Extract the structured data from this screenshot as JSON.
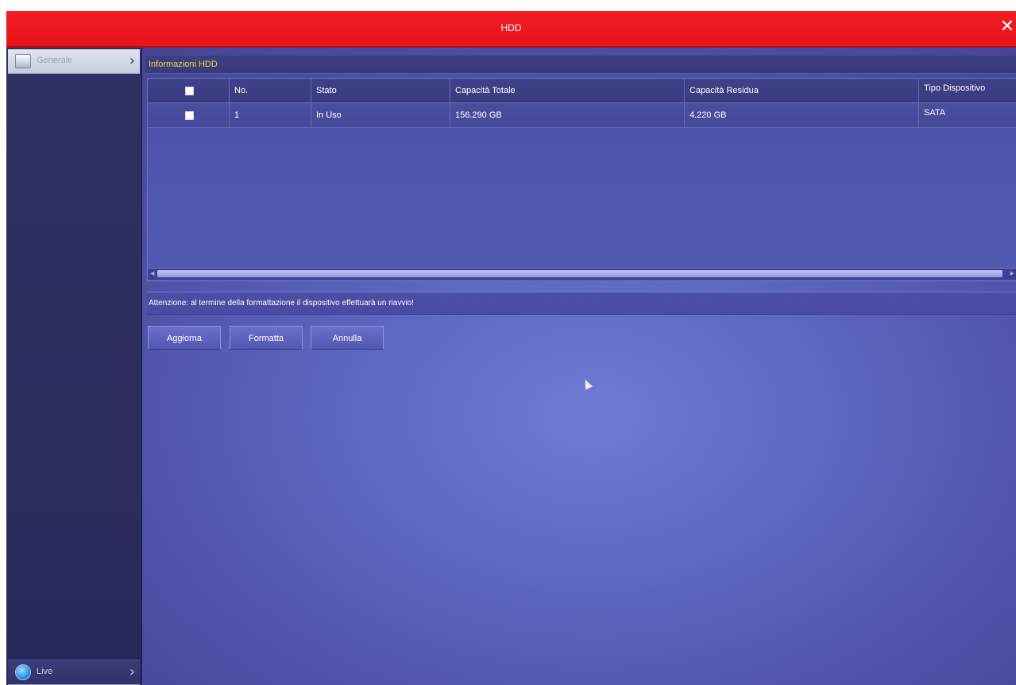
{
  "window": {
    "title": "HDD",
    "close_icon": "close-icon",
    "titlebar_color": "#ec1920"
  },
  "sidebar": {
    "items": [
      {
        "label": "Generale",
        "icon": "settings-panel-icon"
      },
      {
        "label": "Live",
        "icon": "live-view-icon"
      }
    ]
  },
  "section": {
    "title": "Informazioni HDD",
    "title_color": "#f2d83a"
  },
  "table": {
    "columns": [
      "",
      "No.",
      "Stato",
      "Capacità Totale",
      "Capacità Residua",
      "Tipo Dispositivo"
    ],
    "rows": [
      {
        "checked": false,
        "no": "1",
        "stato": "In Uso",
        "capacita_totale": "156.290 GB",
        "capacita_residua": "4.220 GB",
        "tipo": "SATA"
      }
    ]
  },
  "notice": {
    "text": "Attenzione: al termine della formattazione il dispositivo effettuarà un riavvio!"
  },
  "buttons": {
    "refresh": "Aggiorna",
    "format": "Formatta",
    "cancel": "Annulla"
  }
}
